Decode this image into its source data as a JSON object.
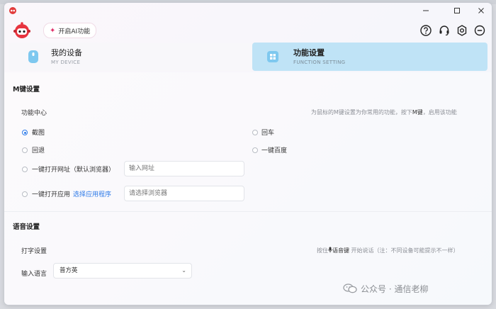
{
  "header": {
    "ai_button_label": "开启AI功能"
  },
  "tabs": [
    {
      "title": "我的设备",
      "subtitle": "MY DEVICE",
      "active": false
    },
    {
      "title": "功能设置",
      "subtitle": "FUNCTION SETTING",
      "active": true
    }
  ],
  "m_key": {
    "section_title": "M键设置",
    "center_label": "功能中心",
    "hint_prefix": "为鼠标的M键设置为你常用的功能，按下",
    "hint_key": "M键",
    "hint_suffix": "，启用该功能",
    "options": {
      "screenshot": "截图",
      "enter": "回车",
      "back": "回退",
      "baidu": "一键百度",
      "open_url": "一键打开网址（默认浏览器）",
      "open_app": "一键打开应用"
    },
    "select_app_link": "选择应用程序",
    "url_placeholder": "输入网址",
    "browser_placeholder": "请选择浏览器",
    "selected_option": "screenshot"
  },
  "voice": {
    "section_title": "语音设置",
    "typing_label": "打字设置",
    "hint_prefix": "按住",
    "hint_key": "语音键",
    "hint_suffix": " 开始说话（注：不同设备可能提示不一样）",
    "language_label": "输入语言",
    "language_value": "普方英"
  },
  "watermark": {
    "text": "公众号 · 通信老柳"
  },
  "colors": {
    "accent": "#2f7be8",
    "active_tab": "#bfe3f6",
    "ai_spark": "#e0306a"
  }
}
